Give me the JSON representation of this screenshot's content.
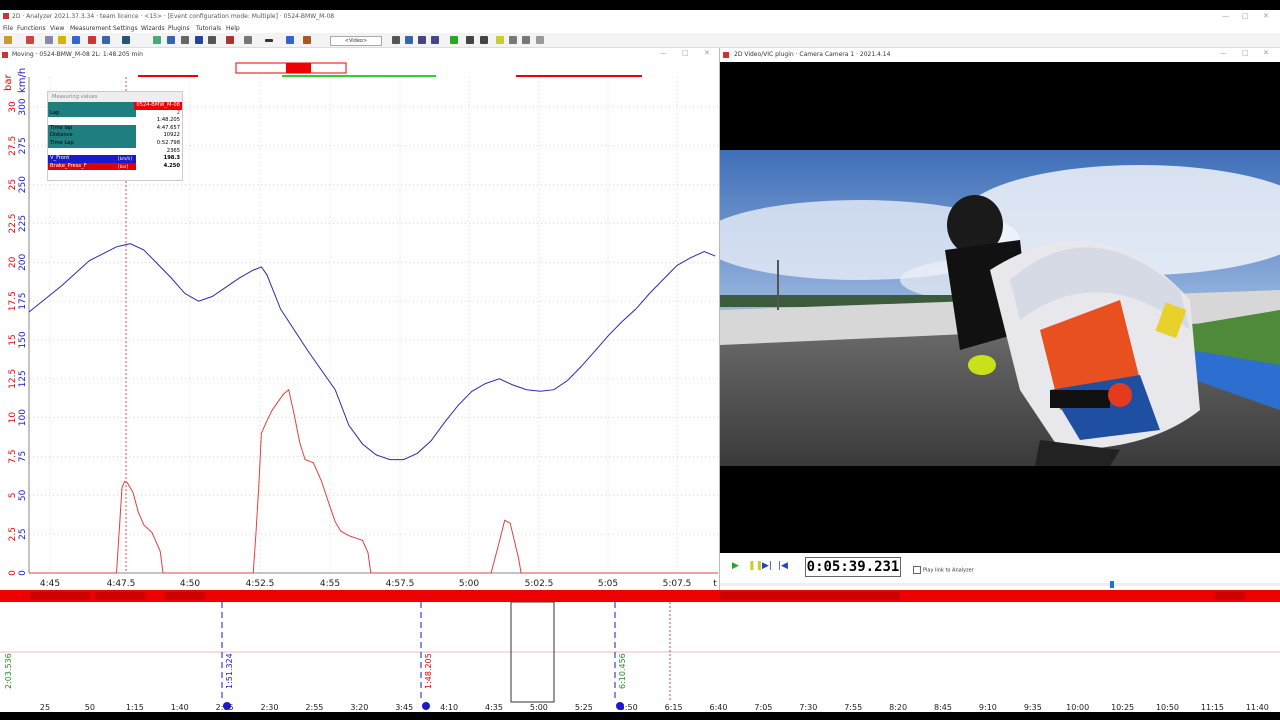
{
  "app": {
    "title": "2D · Analyzer 2021.37.3.34 · team licence · <15> · [Event configuration mode: Multiple] · 0524-BMW_M-08",
    "menu": [
      "File",
      "Functions",
      "View",
      "Measurement",
      "Settings",
      "Wizards",
      "Plugins",
      "Tutorials",
      "Help"
    ],
    "video_dropdown": "<Video>"
  },
  "chart_window": {
    "title": "Moving · 0524-BMW_M-08 2L: 1:48.205 min",
    "left_axis_unit": "bar",
    "right_axis_unit": "km/h",
    "bar_ticks": [
      "30",
      "27.5",
      "25",
      "22.5",
      "20",
      "17.5",
      "15",
      "12.5",
      "10",
      "7.5",
      "5",
      "2.5",
      "0"
    ],
    "kmh_ticks": [
      "300",
      "275",
      "250",
      "225",
      "200",
      "175",
      "150",
      "125",
      "100",
      "75",
      "50",
      "25",
      "0"
    ],
    "x_ticks": [
      "4:45",
      "4:47.5",
      "4:50",
      "4:52.5",
      "4:55",
      "4:57.5",
      "5:00",
      "5:02.5",
      "5:05",
      "5:07.5",
      "t"
    ]
  },
  "measuring": {
    "title": "Measuring values",
    "header_value": "0524-BMW_M-08",
    "rows": [
      {
        "label": "Lap",
        "value": "2",
        "accent": "#e00000"
      },
      {
        "label": "",
        "value": "1:48.205"
      },
      {
        "label": "Time lap",
        "value": "4:47.657"
      },
      {
        "label": "Distance",
        "value": "10922"
      },
      {
        "label": "Time Lap",
        "value": "0:52.798"
      },
      {
        "label": "",
        "value": "2365"
      },
      {
        "label": "V_Front",
        "value": "198.3",
        "unit": "[km/h]",
        "color": "#1a1acc"
      },
      {
        "label": "Brake_Press_F",
        "value": "4.250",
        "unit": "[bar]",
        "color": "#e00000"
      }
    ]
  },
  "video_window": {
    "title": "2D Video/VIC plugin · Camera Camera 1 · 2021.4.14",
    "timecode": "0:05:39.231",
    "play_link_label": "Play link to Analyzer"
  },
  "bottom_panel": {
    "lap_markers": [
      {
        "label": "2:03.536",
        "color": "#2a8a2a"
      },
      {
        "label": "1:51.324",
        "color": "#1a1acc"
      },
      {
        "label": "1:48.205",
        "color": "#e00000"
      },
      {
        "label": "6:10.456",
        "color": "#2a8a2a"
      }
    ],
    "time_ticks": [
      "25",
      "50",
      "1:15",
      "1:40",
      "2:05",
      "2:30",
      "2:55",
      "3:20",
      "3:45",
      "4:10",
      "4:35",
      "5:00",
      "5:25",
      "5:50",
      "6:15",
      "6:40",
      "7:05",
      "7:30",
      "7:55",
      "8:20",
      "8:45",
      "9:10",
      "9:35",
      "10:00",
      "10:25",
      "10:50",
      "11:15",
      "11:40"
    ]
  },
  "chart_data": [
    {
      "type": "line",
      "title": "",
      "x_unit": "min:s",
      "xlim": [
        "4:43.8",
        "5:09"
      ],
      "series": [
        {
          "name": "V_Front",
          "unit": "km/h",
          "color": "#2b2bb0",
          "ylim": [
            0,
            300
          ],
          "x": [
            "4:43.8",
            "4:45",
            "4:46",
            "4:47",
            "4:47.5",
            "4:48",
            "4:48.5",
            "4:49",
            "4:49.5",
            "4:50",
            "4:50.5",
            "4:51",
            "4:51.5",
            "4:52",
            "4:52.3",
            "4:52.5",
            "4:53",
            "4:54",
            "4:55",
            "4:55.5",
            "4:56",
            "4:56.5",
            "4:57",
            "4:57.5",
            "4:58",
            "4:58.5",
            "4:59",
            "4:59.5",
            "5:00",
            "5:00.5",
            "5:01",
            "5:01.5",
            "5:02",
            "5:02.5",
            "5:03",
            "5:03.5",
            "5:04",
            "5:04.5",
            "5:05",
            "5:05.5",
            "5:06",
            "5:06.5",
            "5:07",
            "5:07.5",
            "5:08",
            "5:08.5",
            "5:08.9"
          ],
          "values": [
            168,
            185,
            201,
            210,
            212,
            208,
            199,
            190,
            180,
            175,
            178,
            184,
            190,
            195,
            197,
            192,
            170,
            143,
            118,
            95,
            83,
            76,
            73,
            73,
            77,
            85,
            97,
            108,
            117,
            122,
            125,
            121,
            118,
            117,
            118,
            124,
            133,
            143,
            153,
            162,
            170,
            180,
            189,
            198,
            203,
            207,
            204
          ]
        },
        {
          "name": "Brake_Press_F",
          "unit": "bar",
          "color": "#e04040",
          "ylim": [
            0,
            30
          ],
          "x": [
            "4:43.8",
            "4:47",
            "4:47.2",
            "4:47.3",
            "4:47.4",
            "4:47.6",
            "4:47.8",
            "4:48",
            "4:48.3",
            "4:48.6",
            "4:48.7",
            "4:52",
            "4:52.1",
            "4:52.2",
            "4:52.3",
            "4:52.5",
            "4:52.7",
            "4:52.9",
            "4:53.1",
            "4:53.3",
            "4:53.5",
            "4:53.7",
            "4:53.9",
            "4:54.2",
            "4:54.5",
            "4:54.8",
            "4:55",
            "4:55.2",
            "4:55.5",
            "4:56",
            "4:56.2",
            "4:56.3",
            "5:00.7",
            "5:01",
            "5:01.2",
            "5:01.4",
            "5:01.7",
            "5:01.8",
            "5:09"
          ],
          "values": [
            0,
            0,
            5.5,
            5.9,
            5.8,
            5.2,
            3.9,
            3.1,
            2.6,
            1.4,
            0,
            0,
            2.5,
            5.5,
            9.0,
            9.8,
            10.5,
            11.0,
            11.5,
            11.8,
            10.2,
            8.4,
            7.3,
            7.1,
            5.9,
            4.3,
            3.3,
            2.7,
            2.4,
            2.1,
            1.3,
            0,
            0,
            2.0,
            3.4,
            3.2,
            1.0,
            0,
            0
          ]
        }
      ]
    }
  ]
}
